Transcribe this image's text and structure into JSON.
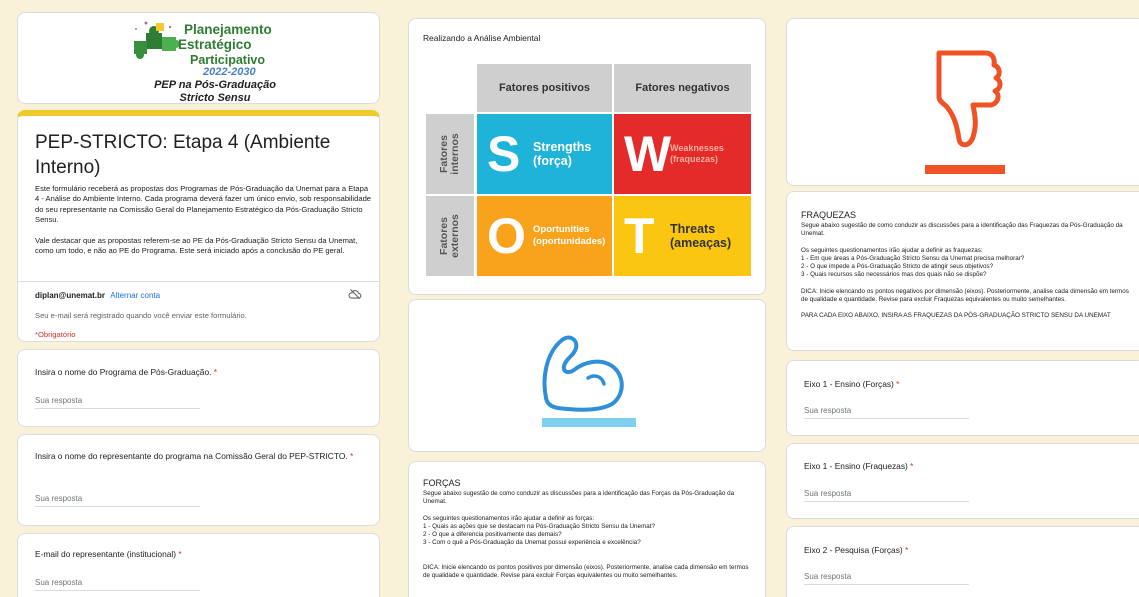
{
  "logo": {
    "line1": "Planejamento",
    "line2": "Estratégico",
    "line3": "Participativo",
    "years": "2022-2030",
    "sub1": "PEP na Pós-Graduação",
    "sub2": "Stricto Sensu"
  },
  "form": {
    "title": "PEP-STRICTO: Etapa 4 (Ambiente Interno)",
    "description": "Este formulário receberá as propostas dos Programas de Pós-Graduação da Unemat para a Etapa 4 - Análise do Ambiente Interno.  Cada programa deverá fazer um único envio, sob responsabilidade do seu representante na Comissão Geral do Planejamento Estratégico da Pós-Graduação Stricto Sensu.\n\nVale destacar que as propostas referem-se ao PE da Pós-Graduação Stricto Sensu da Unemat, como um todo, e não ao PE do Programa. Este será iniciado após a conclusão do PE geral.",
    "account_email": "diplan@unemat.br",
    "switch_account": "Alternar conta",
    "email_note": "Seu e-mail será registrado quando você enviar este formulário.",
    "required_note": "*Obrigatório"
  },
  "questions": [
    {
      "label": "Insira o nome do Programa de Pós-Graduação.",
      "placeholder": "Sua resposta"
    },
    {
      "label": "Insira o nome do representante do programa na Comissão Geral do PEP-STRICTO.",
      "placeholder": "Sua resposta"
    },
    {
      "label": "E-mail do representante (institucional)",
      "placeholder": "Sua resposta"
    }
  ],
  "swot": {
    "section_label": "Realizando a Análise Ambiental",
    "header_positive": "Fatores positivos",
    "header_negative": "Fatores negativos",
    "side_internal": "Fatores\ninternos",
    "side_external": "Fatores\nexternos",
    "s_letter": "S",
    "s_text": "Strengths\n(força)",
    "w_letter": "W",
    "w_text": "Weaknesses\n(fraquezas)",
    "o_letter": "O",
    "o_text": "Oportunities\n(oportunidades)",
    "t_letter": "T",
    "t_text": "Threats\n(ameaças)",
    "colors": {
      "s": "#1fb3d9",
      "w": "#e52a2a",
      "o": "#f9a21b",
      "t": "#fbc612"
    }
  },
  "forcas": {
    "title": "FORÇAS",
    "body": "Segue abaixo sugestão de como conduzir as discussões para a identificação das Forças da Pós-Graduação da Unemat.\n\nOs seguintes questionamentos irão ajudar a definir as forças:\n1 - Quais as ações que se destacam na Pós-Graduação Stricto Sensu da Unemat?\n2 - O que a diferencia positivamente das demais?\n3 - Com o quê a Pós-Graduação da Unemat possui experiência e excelência?\n\n\nDICA: Inicie elencando os pontos positivos por dimensão (eixos). Posteriormente, analise cada dimensão em termos de qualidade e quantidade.  Revise para excluir Forças equivalentes ou muito semelhantes."
  },
  "fraquezas": {
    "title": "FRAQUEZAS",
    "body": "Segue abaixo sugestão de como conduzir as discussões para a identificação das Fraquezas da Pós-Graduação da Unemat.\n\nOs seguintes questionamentos irão ajudar a definir as fraquezas:\n1 - Em que áreas a Pós-Graduação Stricto Sensu da Unemat precisa melhorar?\n2 - O que impede a Pós-Graduação Stricto de atingir seus objetivos?\n3 - Quais recursos são necessários mas dos quais não se dispõe?\n\nDICA: Inicie elencando os pontos negativos por dimensão (eixos). Posteriormente, analise cada dimensão em termos de qualidade e quantidade.  Revise para excluir Fraquezas equivalentes ou muito semelhantes.\n\nPARA CADA EIXO ABAIXO, INSIRA AS FRAQUEZAS DA PÓS-GRADUAÇÃO STRICTO SENSU DA UNEMAT"
  },
  "eixos": [
    {
      "label": "Eixo 1 - Ensino (Forças)",
      "placeholder": "Sua resposta"
    },
    {
      "label": "Eixo 1 - Ensino (Fraquezas)",
      "placeholder": "Sua resposta"
    },
    {
      "label": "Eixo 2 - Pesquisa (Forças)",
      "placeholder": "Sua resposta"
    }
  ],
  "asterisk": "*",
  "icons": {
    "cloud": "cloud-off-icon",
    "muscle": "flexed-arm-icon",
    "thumb": "thumbs-down-icon"
  }
}
